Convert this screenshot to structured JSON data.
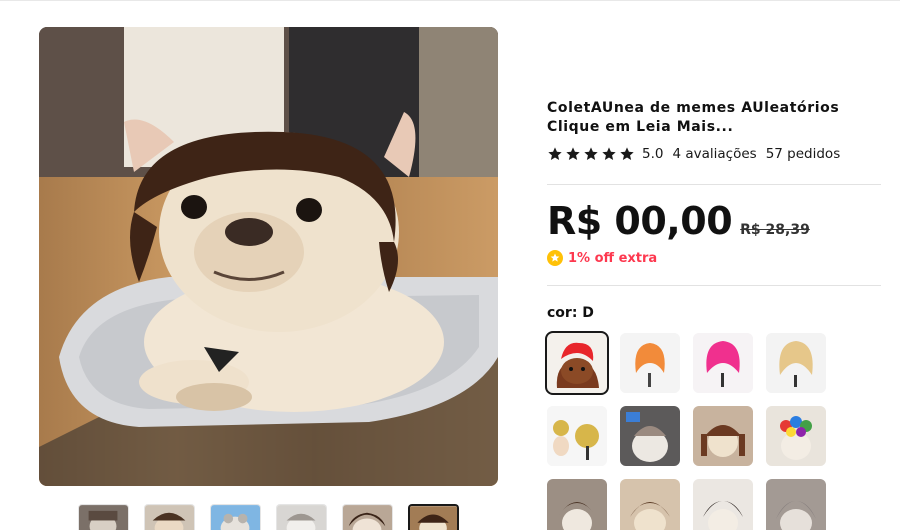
{
  "product": {
    "title_line1": "ColetAUnea de memes AUleatórios",
    "title_line2": "Clique em Leia Mais...",
    "rating": "5.0",
    "reviews": "4 avaliações",
    "orders": "57 pedidos",
    "star_color": "#191919",
    "star_count": 5
  },
  "pricing": {
    "price": "R$ 00,00",
    "original_price": "R$ 28,39",
    "promo_text": "1% off extra",
    "promo_color": "#fd384f",
    "coin_color": "#ffc107"
  },
  "variants": {
    "color_label": "cor: D",
    "selected_index": 0,
    "swatches": [
      {
        "name": "red-wig-dog",
        "wig_color": "#e8262b"
      },
      {
        "name": "orange-wig",
        "wig_color": "#f28b3a"
      },
      {
        "name": "pink-wig",
        "wig_color": "#f0308e"
      },
      {
        "name": "blonde-wig",
        "wig_color": "#e6c78a"
      },
      {
        "name": "yellow-wig-dog",
        "wig_color": "#d7b64a"
      },
      {
        "name": "cat-wig",
        "wig_color": "#9a8a80"
      },
      {
        "name": "pigtails-wig",
        "wig_color": "#6b3a22"
      },
      {
        "name": "rainbow-wig",
        "wig_color": "#2a7de1"
      },
      {
        "name": "brown-bob-dog",
        "wig_color": "#4a3325"
      },
      {
        "name": "brown-bob-frenchie",
        "wig_color": "#5a3a24"
      },
      {
        "name": "black-bob-dog",
        "wig_color": "#2b2320"
      },
      {
        "name": "gray-wig-cat",
        "wig_color": "#8a8280"
      }
    ]
  },
  "gallery": {
    "thumbnail_count": 6,
    "active_thumbnail": 5
  }
}
